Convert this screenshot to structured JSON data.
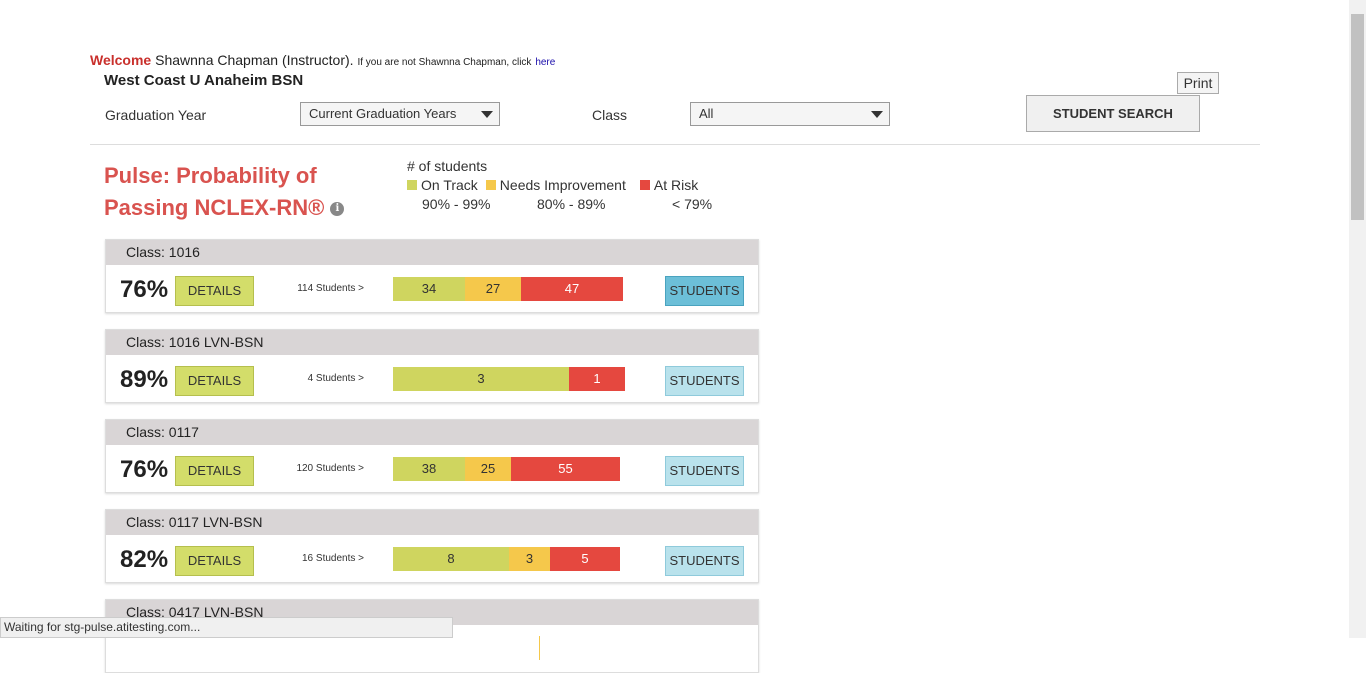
{
  "header": {
    "welcome_label": "Welcome",
    "user_name": "Shawnna Chapman (Instructor).",
    "not_user_text": "If you are not Shawnna Chapman, click",
    "here_link": "here",
    "school": "West Coast U Anaheim BSN",
    "print_label": "Print"
  },
  "filters": {
    "graduation_year_label": "Graduation Year",
    "graduation_year_value": "Current Graduation Years",
    "class_label": "Class",
    "class_value": "All",
    "student_search_label": "STUDENT SEARCH"
  },
  "pulse": {
    "title_line1": "Pulse: Probability of",
    "title_line2": "Passing NCLEX-RN®",
    "legend_title": "# of students",
    "on_track": "On Track",
    "needs_improvement": "Needs Improvement",
    "at_risk": "At Risk",
    "on_track_range": "90% - 99%",
    "needs_improvement_range": "80% - 89%",
    "at_risk_range": "< 79%",
    "colors": {
      "on_track": "#cfd55f",
      "needs_improvement": "#f5c84b",
      "at_risk": "#e5483f"
    }
  },
  "classes": [
    {
      "name": "Class: 1016",
      "percent": "76%",
      "details": "DETAILS",
      "count": "114 Students >",
      "on_track": "34",
      "needs_improvement": "27",
      "at_risk": "47",
      "students": "STUDENTS"
    },
    {
      "name": "Class: 1016 LVN-BSN",
      "percent": "89%",
      "details": "DETAILS",
      "count": "4 Students >",
      "on_track": "3",
      "needs_improvement": "",
      "at_risk": "1",
      "students": "STUDENTS"
    },
    {
      "name": "Class: 0117",
      "percent": "76%",
      "details": "DETAILS",
      "count": "120 Students >",
      "on_track": "38",
      "needs_improvement": "25",
      "at_risk": "55",
      "students": "STUDENTS"
    },
    {
      "name": "Class: 0117 LVN-BSN",
      "percent": "82%",
      "details": "DETAILS",
      "count": "16 Students >",
      "on_track": "8",
      "needs_improvement": "3",
      "at_risk": "5",
      "students": "STUDENTS"
    },
    {
      "name": "Class: 0417 LVN-BSN"
    }
  ],
  "status_bar": "Waiting for stg-pulse.atitesting.com..."
}
